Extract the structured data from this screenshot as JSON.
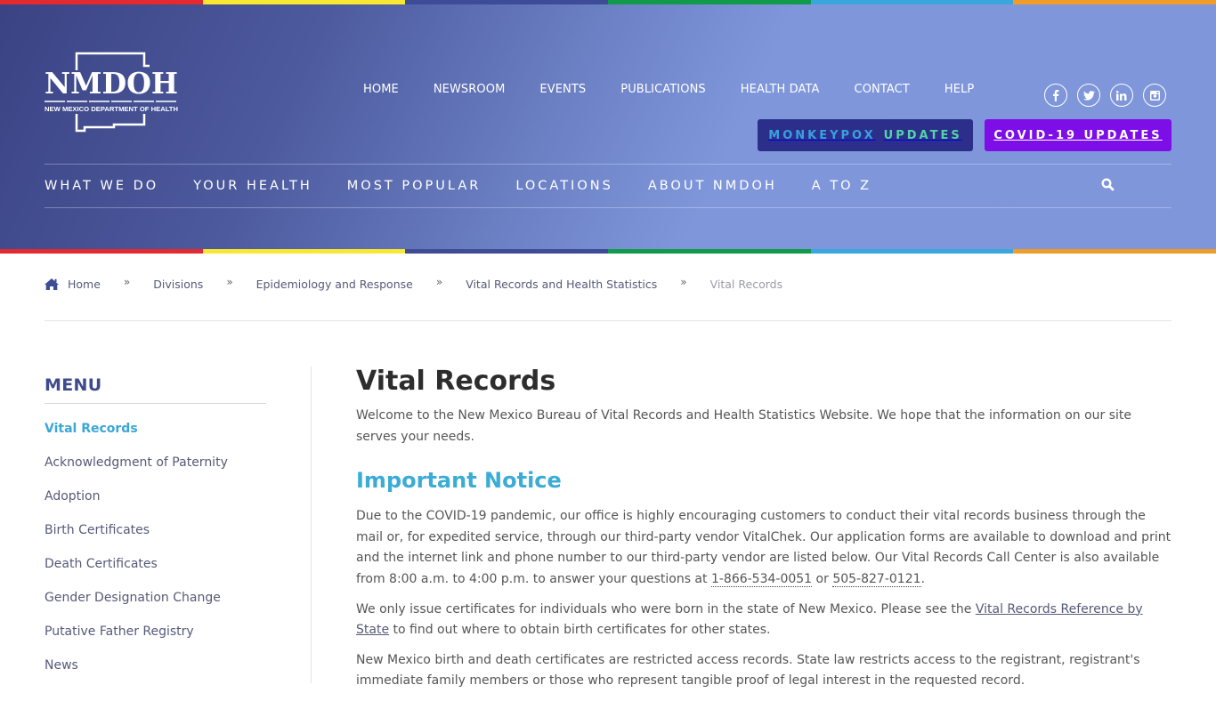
{
  "brand": {
    "name": "NMDOH",
    "tagline": "NEW MEXICO DEPARTMENT OF HEALTH",
    "stripe_colors": [
      "#e42a2f",
      "#f9e832",
      "#3e4b96",
      "#119a4a",
      "#3aa7dc",
      "#ef9c2b"
    ]
  },
  "utility_nav": [
    "HOME",
    "NEWSROOM",
    "EVENTS",
    "PUBLICATIONS",
    "HEALTH DATA",
    "CONTACT",
    "HELP"
  ],
  "socials": [
    {
      "name": "facebook-icon",
      "glyph": "f"
    },
    {
      "name": "twitter-icon",
      "glyph": "t"
    },
    {
      "name": "linkedin-icon",
      "glyph": "in"
    },
    {
      "name": "instagram-icon",
      "glyph": "ig"
    }
  ],
  "cta": {
    "monkeypox_word1": "MONKEYPOX",
    "monkeypox_word2": "UPDATES",
    "covid": "COVID-19 UPDATES"
  },
  "main_nav": [
    "WHAT WE DO",
    "YOUR HEALTH",
    "MOST POPULAR",
    "LOCATIONS",
    "ABOUT NMDOH",
    "A TO Z"
  ],
  "breadcrumb": {
    "items": [
      "Home",
      "Divisions",
      "Epidemiology and Response",
      "Vital Records and Health Statistics"
    ],
    "separator": "»",
    "current": "Vital Records"
  },
  "sidebar": {
    "title": "MENU",
    "items": [
      {
        "label": "Vital Records",
        "active": true
      },
      {
        "label": "Acknowledgment of Paternity"
      },
      {
        "label": "Adoption"
      },
      {
        "label": "Birth Certificates"
      },
      {
        "label": "Death Certificates"
      },
      {
        "label": "Gender Designation Change"
      },
      {
        "label": "Putative Father Registry"
      },
      {
        "label": "News"
      }
    ]
  },
  "content": {
    "title": "Vital Records",
    "intro": "Welcome to the New Mexico Bureau of Vital Records and Health Statistics Website. We hope that the information on our site serves your needs.",
    "notice_heading": "Important Notice",
    "p1_text": "Due to the COVID-19 pandemic, our office is highly encouraging customers to conduct their vital records business through the mail or, for expedited service, through our third-party vendor VitalChek. Our application forms are available to download and print and the internet link and phone number to our third-party vendor are listed below. Our Vital Records Call Center is also available from 8:00 a.m. to 4:00 p.m. to answer your questions at ",
    "phone1": "1-866-534-0051",
    "p1_or": " or ",
    "phone2": "505-827-0121",
    "p1_end": ".",
    "p2_text": "We only issue certificates for individuals who were born in the state of New Mexico. Please see the ",
    "p2_link": "Vital Records Reference by State",
    "p2_end": " to find out where to obtain birth certificates for other states.",
    "p3_text": "New Mexico birth and death certificates are restricted access records. State law restricts access to the registrant, registrant's immediate family members or those who represent tangible proof of legal interest in the requested record."
  }
}
